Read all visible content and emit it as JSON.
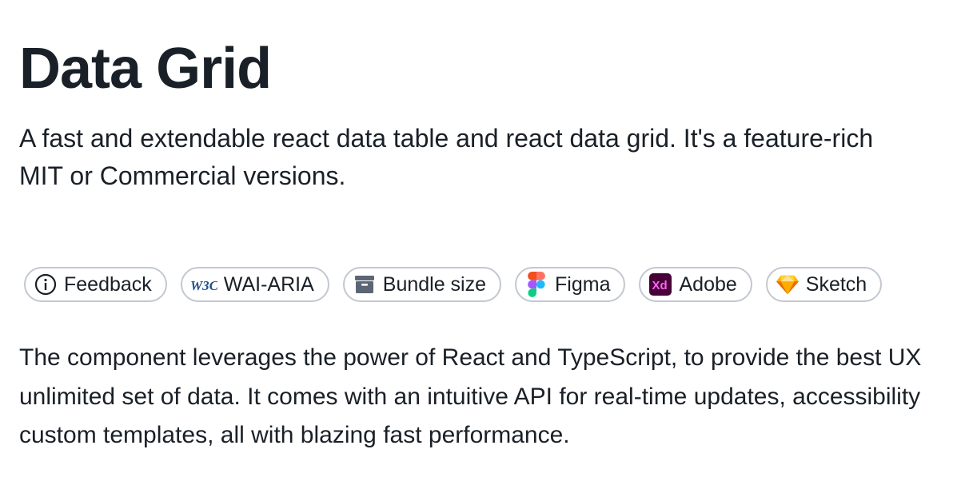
{
  "page": {
    "title": "Data Grid",
    "lead_line1": "A fast and extendable react data table and react data grid. It's a feature-rich",
    "lead_line2": "MIT or Commercial versions.",
    "body_line1": "The component leverages the power of React and TypeScript, to provide the best UX",
    "body_line2": "unlimited set of data. It comes with an intuitive API for real-time updates, accessibility",
    "body_line3": "custom templates, all with blazing fast performance."
  },
  "chips": [
    {
      "label": "Feedback",
      "icon": "info-icon"
    },
    {
      "label": "WAI-ARIA",
      "icon": "w3c-icon"
    },
    {
      "label": "Bundle size",
      "icon": "package-icon"
    },
    {
      "label": "Figma",
      "icon": "figma-icon"
    },
    {
      "label": "Adobe",
      "icon": "adobe-xd-icon"
    },
    {
      "label": "Sketch",
      "icon": "sketch-icon"
    }
  ],
  "icon_text": {
    "w3c": "W3C",
    "xd": "Xd"
  },
  "colors": {
    "text": "#1a2027",
    "chip_border": "#c2c8d0",
    "icon_gray": "#5a6675",
    "w3c_blue": "#1f4f8c",
    "xd_bg": "#470137",
    "xd_text": "#ff61f6",
    "figma_red": "#f24e1e",
    "figma_orange": "#ff7262",
    "figma_purple": "#a259ff",
    "figma_blue": "#1abcfe",
    "figma_green": "#0acf83",
    "sketch_yellow": "#fdb300"
  }
}
